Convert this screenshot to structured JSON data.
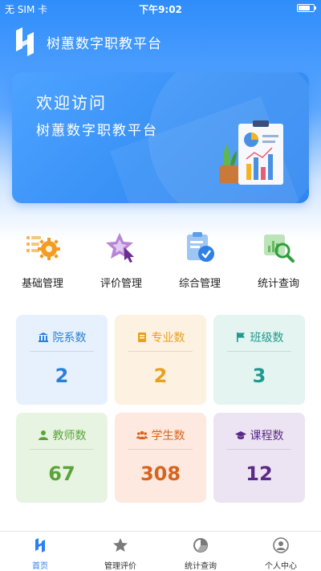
{
  "status_bar": {
    "carrier": "无 SIM 卡",
    "time": "下午9:02",
    "battery_level": 0.8
  },
  "app": {
    "title": "树蕙数字职教平台"
  },
  "banner": {
    "title": "欢迎访问",
    "subtitle": "树蕙数字职教平台"
  },
  "quick_actions": [
    {
      "label": "基础管理",
      "icon": "gear-list-icon"
    },
    {
      "label": "评价管理",
      "icon": "star-cursor-icon"
    },
    {
      "label": "综合管理",
      "icon": "clipboard-check-icon"
    },
    {
      "label": "统计查询",
      "icon": "chart-search-icon"
    }
  ],
  "stats": [
    {
      "label": "院系数",
      "value": "2",
      "icon": "building-icon",
      "color": "#2b7fd6",
      "bg": "#e6f1fd"
    },
    {
      "label": "专业数",
      "value": "2",
      "icon": "book-icon",
      "color": "#e8a020",
      "bg": "#fdf1e1"
    },
    {
      "label": "班级数",
      "value": "3",
      "icon": "flag-icon",
      "color": "#1f9a8c",
      "bg": "#e3f4f1"
    },
    {
      "label": "教师数",
      "value": "67",
      "icon": "person-icon",
      "color": "#5aa43a",
      "bg": "#e8f4e2"
    },
    {
      "label": "学生数",
      "value": "308",
      "icon": "group-icon",
      "color": "#d8651f",
      "bg": "#fde9df"
    },
    {
      "label": "课程数",
      "value": "12",
      "icon": "graduation-cap-icon",
      "color": "#5b2a86",
      "bg": "#ece4f3"
    }
  ],
  "tabbar": [
    {
      "label": "首页",
      "icon": "home-logo-icon",
      "active": true
    },
    {
      "label": "管理评价",
      "icon": "star-icon",
      "active": false
    },
    {
      "label": "统计查询",
      "icon": "pie-chart-icon",
      "active": false
    },
    {
      "label": "个人中心",
      "icon": "user-icon",
      "active": false
    }
  ],
  "colors": {
    "primary": "#2f8dfb",
    "active_tab": "#2b7ff5"
  }
}
